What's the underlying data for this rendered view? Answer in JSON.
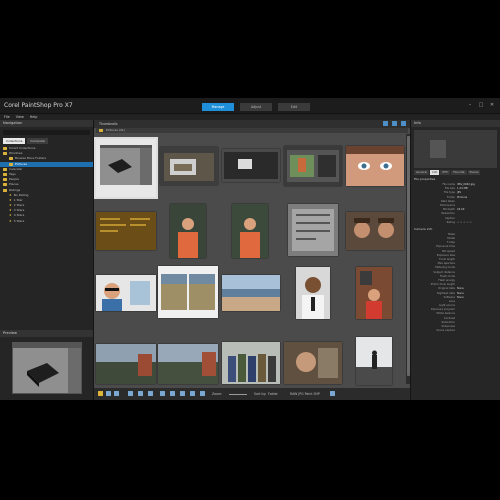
{
  "titlebar": {
    "app_title": "Corel PaintShop Pro X7",
    "tabs": [
      {
        "label": "Manage",
        "active": true
      },
      {
        "label": "Adjust",
        "active": false
      },
      {
        "label": "Edit",
        "active": false
      }
    ],
    "window_buttons": [
      "–",
      "□",
      "✕"
    ]
  },
  "menu": [
    "File",
    "View",
    "Help"
  ],
  "navigation": {
    "title": "Navigation",
    "tabs": [
      {
        "label": "Collections",
        "active": true
      },
      {
        "label": "Computer",
        "active": false
      }
    ],
    "tree": [
      {
        "label": "Smart Collections",
        "icon": "folder"
      },
      {
        "label": "Windows",
        "icon": "folder"
      },
      {
        "label": "Browse More Folders",
        "icon": "folder"
      },
      {
        "label": "Pictures",
        "icon": "folder",
        "selected": true
      },
      {
        "label": "Calendar",
        "icon": "folder"
      },
      {
        "label": "Tags",
        "icon": "folder"
      },
      {
        "label": "People",
        "icon": "folder"
      },
      {
        "label": "Places",
        "icon": "folder"
      },
      {
        "label": "Ratings",
        "icon": "folder"
      },
      {
        "label": "No Rating",
        "icon": "star"
      },
      {
        "label": "1 Star",
        "icon": "star"
      },
      {
        "label": "2 Stars",
        "icon": "star"
      },
      {
        "label": "3 Stars",
        "icon": "star"
      },
      {
        "label": "4 Stars",
        "icon": "star"
      },
      {
        "label": "5 Stars",
        "icon": "star"
      }
    ]
  },
  "preview": {
    "title": "Preview"
  },
  "main": {
    "tab": "Thumbnails",
    "breadcrumb": "Pictures (41)"
  },
  "bottom_toolbar": {
    "zoom_label": "Zoom:",
    "sort_label": "Sort by:",
    "sort_value": "Folder",
    "format_value": "RAW JPG Paint SHP"
  },
  "info": {
    "title": "Info",
    "tabs": [
      {
        "label": "General",
        "active": false
      },
      {
        "label": "Info",
        "active": true
      },
      {
        "label": "IPTC",
        "active": false
      },
      {
        "label": "Favorite",
        "active": false
      },
      {
        "label": "Places",
        "active": false
      }
    ],
    "section_general": "File properties",
    "general": [
      {
        "label": "File name",
        "value": "IMG_0042.jpg"
      },
      {
        "label": "File size",
        "value": "1.24 MB"
      },
      {
        "label": "File type",
        "value": "JPG"
      },
      {
        "label": "Folder",
        "value": "Pictures"
      },
      {
        "label": "Date taken",
        "value": ""
      },
      {
        "label": "Dimensions",
        "value": ""
      },
      {
        "label": "Bit depth",
        "value": "24 bit"
      },
      {
        "label": "Resolution",
        "value": ""
      },
      {
        "label": "Caption",
        "value": ""
      },
      {
        "label": "Rating",
        "value": "☆ ☆ ☆ ☆ ☆"
      }
    ],
    "section_camera": "Camera info",
    "camera": [
      {
        "label": "Make",
        "value": ""
      },
      {
        "label": "Model",
        "value": ""
      },
      {
        "label": "F-stop",
        "value": ""
      },
      {
        "label": "Exposure time",
        "value": ""
      },
      {
        "label": "ISO speed",
        "value": ""
      },
      {
        "label": "Exposure bias",
        "value": ""
      },
      {
        "label": "Focal length",
        "value": ""
      },
      {
        "label": "Max aperture",
        "value": ""
      },
      {
        "label": "Metering mode",
        "value": ""
      },
      {
        "label": "Subject distance",
        "value": ""
      },
      {
        "label": "Flash mode",
        "value": ""
      },
      {
        "label": "Flash energy",
        "value": ""
      },
      {
        "label": "35mm focal length",
        "value": ""
      },
      {
        "label": "Original date",
        "value": "None"
      },
      {
        "label": "Digitized date",
        "value": "None"
      },
      {
        "label": "Software",
        "value": "None"
      },
      {
        "label": "Lens",
        "value": ""
      },
      {
        "label": "Light source",
        "value": ""
      },
      {
        "label": "Exposure program",
        "value": ""
      },
      {
        "label": "White balance",
        "value": ""
      },
      {
        "label": "Contrast",
        "value": ""
      },
      {
        "label": "Saturation",
        "value": ""
      },
      {
        "label": "Sharpness",
        "value": ""
      },
      {
        "label": "Scene capture",
        "value": ""
      }
    ]
  },
  "colors": {
    "accent": "#1e8fd8",
    "selected_row": "#1e6fb0",
    "folder": "#d9b23a",
    "background": "#2b2b2b",
    "grid_background": "#4b4b4b"
  }
}
